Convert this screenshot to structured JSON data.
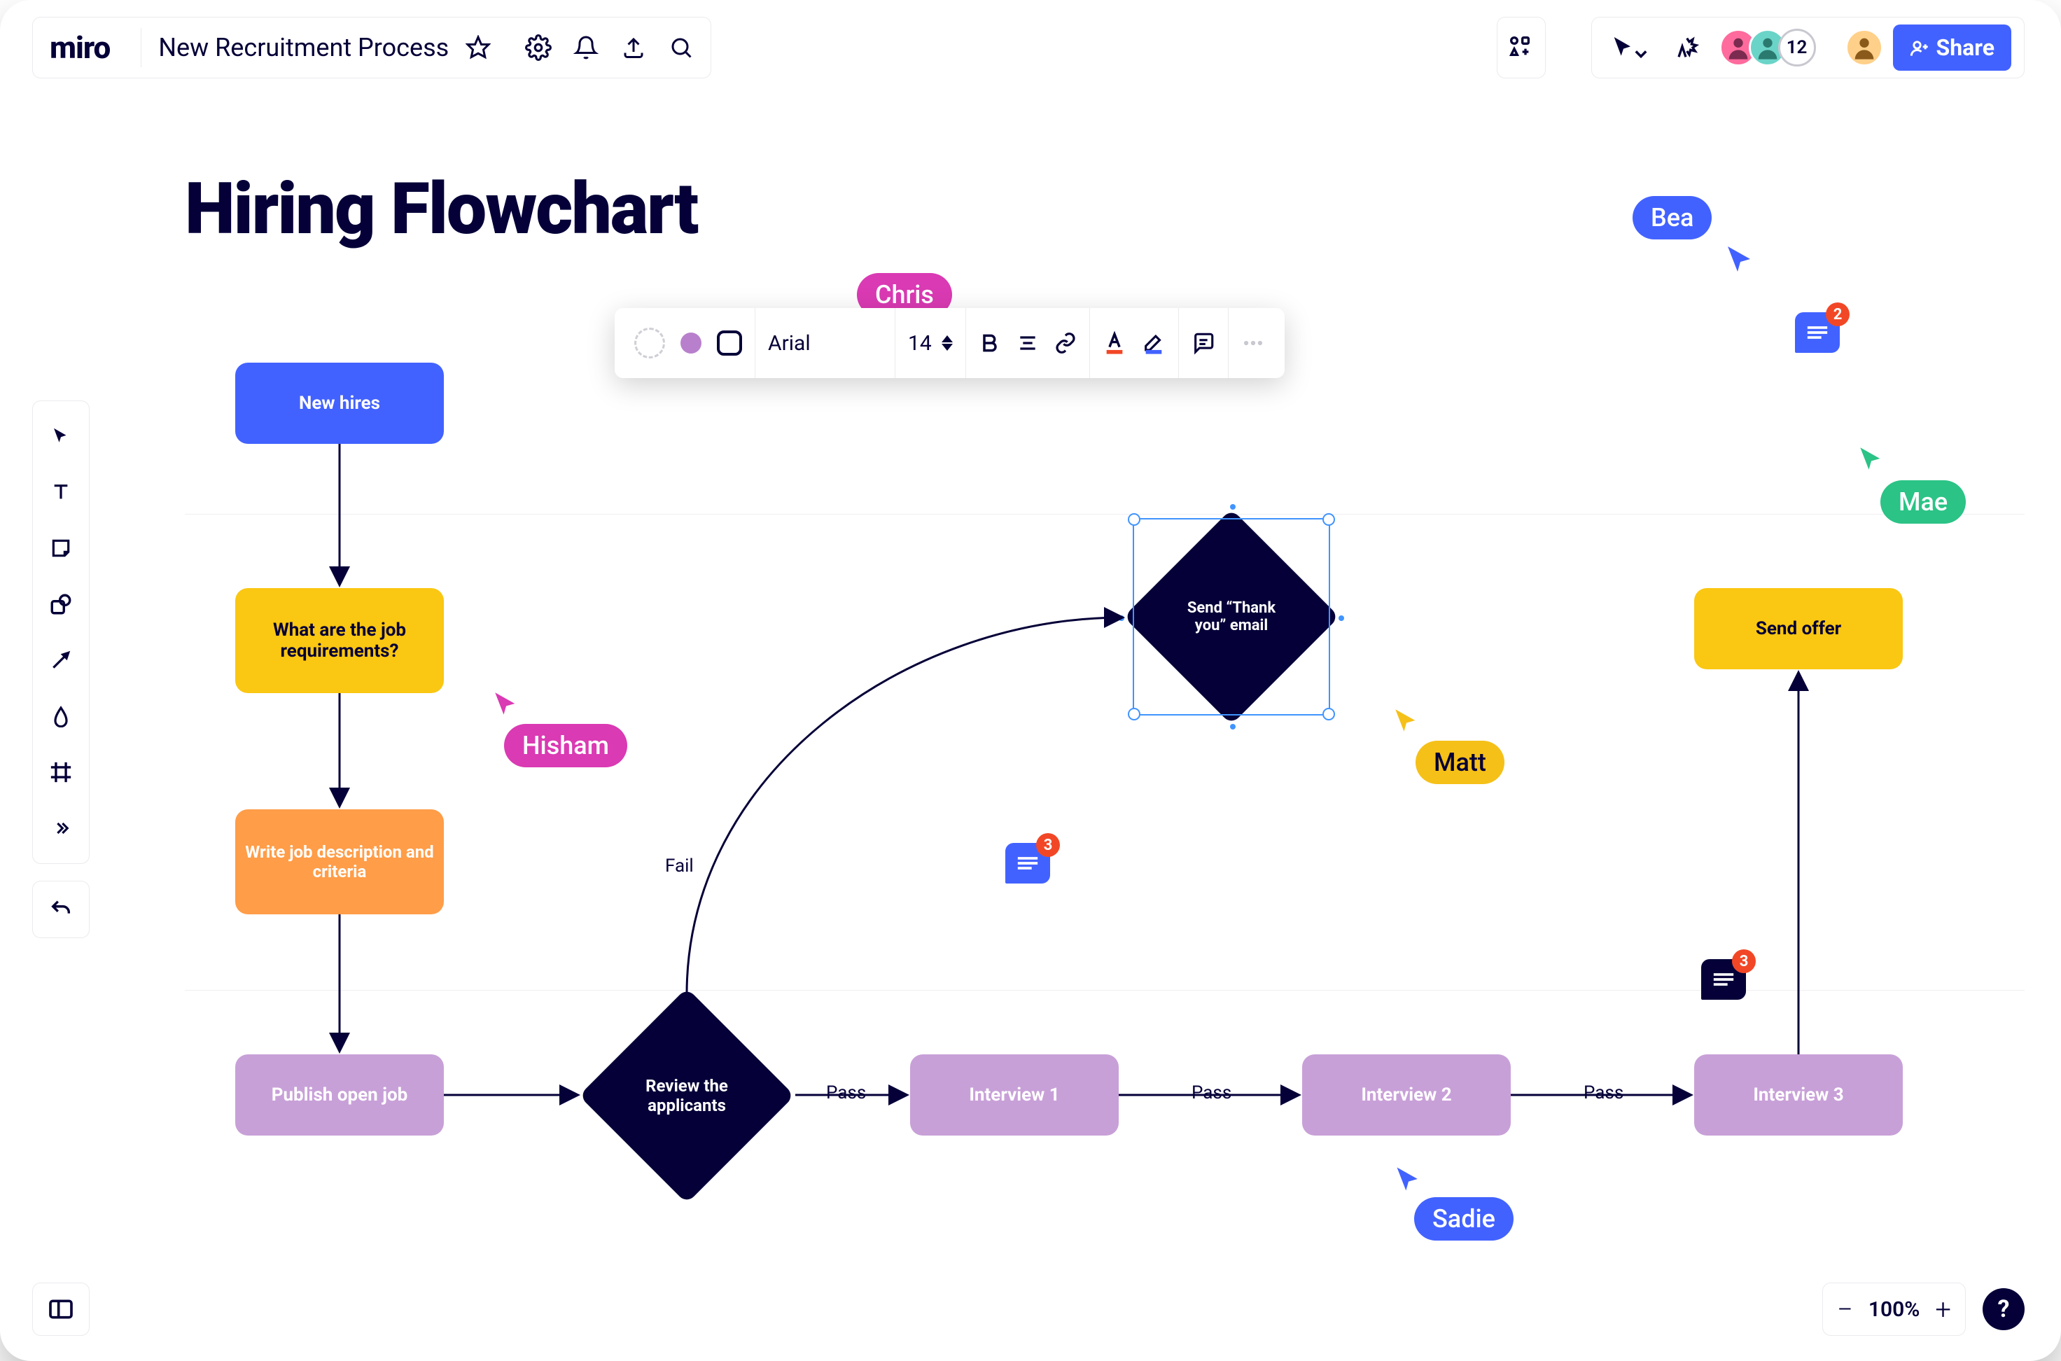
{
  "header": {
    "logo": "miro",
    "board_name": "New Recruitment Process",
    "share_label": "Share",
    "avatar_overflow": "12"
  },
  "zoom": {
    "minus": "−",
    "pct": "100%",
    "plus": "+",
    "help": "?"
  },
  "canvas": {
    "title": "Hiring Flowchart"
  },
  "nodes": {
    "new_hires": "New hires",
    "requirements": "What are the job requirements?",
    "write_desc": "Write job description and criteria",
    "publish": "Publish open job",
    "review": "Review the applicants",
    "thankyou": "Send “Thank you” email",
    "interview1": "Interview 1",
    "interview2": "Interview 2",
    "interview3": "Interview 3",
    "offer": "Send offer"
  },
  "edges": {
    "fail": "Fail",
    "pass1": "Pass",
    "pass2": "Pass",
    "pass3": "Pass"
  },
  "cursors": {
    "chris": "Chris",
    "hisham": "Hisham",
    "bea": "Bea",
    "mae": "Mae",
    "matt": "Matt",
    "sadie": "Sadie"
  },
  "bubbles": {
    "b1": "3",
    "b2": "2",
    "b3": "3"
  },
  "ctx": {
    "font": "Arial",
    "size": "14"
  },
  "colors": {
    "blue": "#4262ff",
    "yellow": "#fac712",
    "orange": "#ff9d48",
    "lilac": "#c8a0d8",
    "navy": "#050038",
    "pink": "#da3ab3",
    "green": "#34c759",
    "greenpill": "#2bc386",
    "gold": "#f5c018",
    "bluecursor": "#4262ff"
  }
}
